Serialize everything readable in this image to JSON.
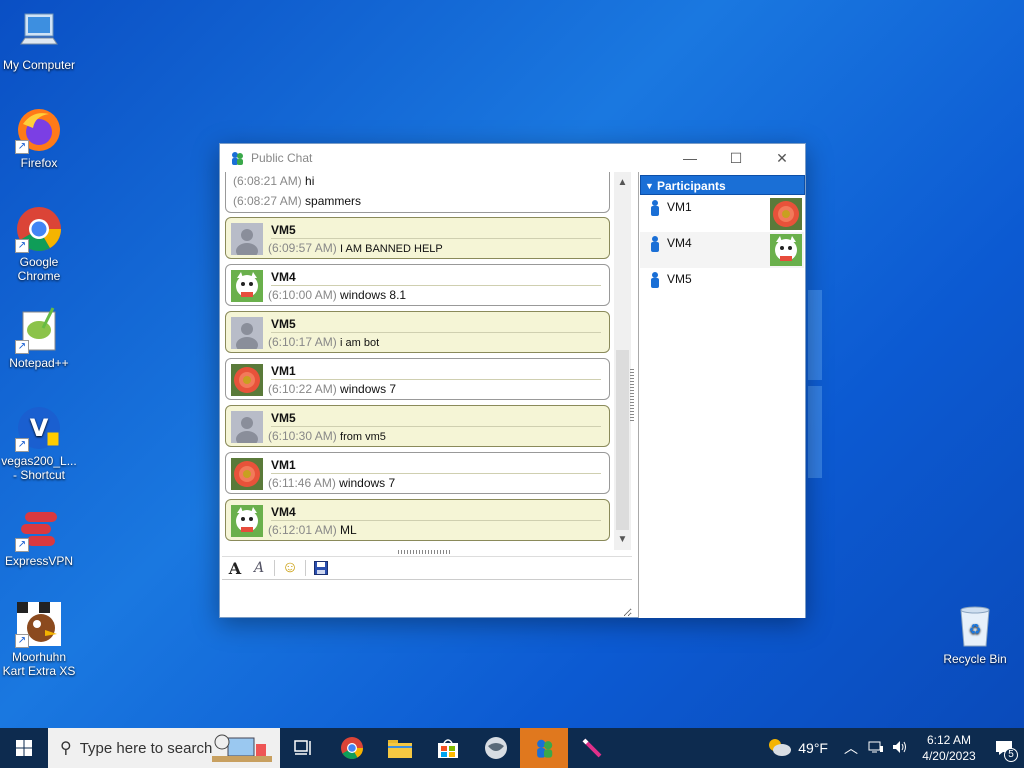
{
  "desktop": {
    "icons": [
      {
        "label": "My Computer"
      },
      {
        "label": "Firefox"
      },
      {
        "label": "Google Chrome"
      },
      {
        "label": "Notepad++"
      },
      {
        "label": "vegas200_L... - Shortcut"
      },
      {
        "label": "ExpressVPN"
      },
      {
        "label": "Moorhuhn Kart Extra XS"
      },
      {
        "label": "Recycle Bin"
      }
    ]
  },
  "window": {
    "title": "Public Chat",
    "controls": {
      "minimize": "—",
      "maximize": "☐",
      "close": "✕"
    }
  },
  "chat": {
    "first": {
      "lines": [
        {
          "time": "(6:08:21 AM)",
          "text": "hi"
        },
        {
          "time": "(6:08:27 AM)",
          "text": "spammers"
        }
      ]
    },
    "messages": [
      {
        "name": "VM5",
        "time": "(6:09:57 AM)",
        "text": "I AM BANNED HELP"
      },
      {
        "name": "VM4",
        "time": "(6:10:00 AM)",
        "text": "windows 8.1"
      },
      {
        "name": "VM5",
        "time": "(6:10:17 AM)",
        "text": "i am bot"
      },
      {
        "name": "VM1",
        "time": "(6:10:22 AM)",
        "text": "windows 7"
      },
      {
        "name": "VM5",
        "time": "(6:10:30 AM)",
        "text": "from vm5"
      },
      {
        "name": "VM1",
        "time": "(6:11:46 AM)",
        "text": "windows 7"
      },
      {
        "name": "VM4",
        "time": "(6:12:01 AM)",
        "text": "ML"
      }
    ],
    "input_value": ""
  },
  "toolbar": {
    "font_icon": "A",
    "font_style_icon": "A",
    "emoji_icon": "☺",
    "save_icon": "💾"
  },
  "participants": {
    "header": "Participants",
    "items": [
      {
        "name": "VM1"
      },
      {
        "name": "VM4"
      },
      {
        "name": "VM5"
      }
    ]
  },
  "taskbar": {
    "search_placeholder": "Type here to search",
    "weather": "49°F",
    "time": "6:12 AM",
    "date": "4/20/2023",
    "notifications": "5"
  }
}
